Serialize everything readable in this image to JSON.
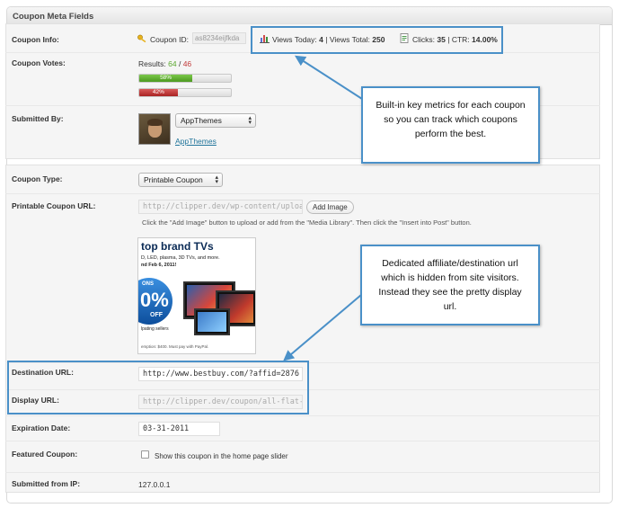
{
  "metabox": {
    "title": "Coupon Meta Fields"
  },
  "fields": {
    "coupon_info": {
      "label": "Coupon Info:",
      "id_label": "Coupon ID:",
      "id_value": "as8234eijfkda",
      "views_today_label": "Views Today:",
      "views_today": "4",
      "views_total_label": "| Views Total:",
      "views_total": "250",
      "clicks_label": "Clicks:",
      "clicks": "35",
      "ctr_label": "| CTR:",
      "ctr": "14.00%"
    },
    "coupon_votes": {
      "label": "Coupon Votes:",
      "results_label": "Results:",
      "up": "64",
      "separator": "/",
      "down": "46",
      "up_pct_label": "58%",
      "down_pct_label": "42%",
      "up_pct": 0.58,
      "down_pct": 0.42
    },
    "submitted_by": {
      "label": "Submitted By:",
      "select_value": "AppThemes",
      "link": "AppThemes"
    },
    "coupon_type": {
      "label": "Coupon Type:",
      "select_value": "Printable Coupon"
    },
    "printable_url": {
      "label": "Printable Coupon URL:",
      "value": "http://clipper.dev/wp-content/uploads/20",
      "button": "Add Image",
      "help": "Click the \"Add Image\" button to upload or add from the \"Media Library\". Then click the \"Insert into Post\" button."
    },
    "coupon_image": {
      "headline": "top brand TVs",
      "line1": "D, LED, plasma, 3D TVs, and more.",
      "line2": "nd Feb 6, 2011!",
      "badge_big": "0%",
      "badge_small": "OFF",
      "badge_top": "ONS",
      "footer": "emption: $400. Must pay with PayPal.",
      "side": "lpating sellers"
    },
    "destination_url": {
      "label": "Destination URL:",
      "value": "http://www.bestbuy.com/?affid=2876"
    },
    "display_url": {
      "label": "Display URL:",
      "value": "http://clipper.dev/coupon/all-flat-screen-"
    },
    "expiration": {
      "label": "Expiration Date:",
      "value": "03-31-2011"
    },
    "featured": {
      "label": "Featured Coupon:",
      "checkbox_label": "Show this coupon in the home page slider",
      "checked": false
    },
    "submitted_ip": {
      "label": "Submitted from IP:",
      "value": "127.0.0.1"
    }
  },
  "callouts": {
    "metrics": "Built-in key metrics for each coupon so you can track which coupons perform the best.",
    "affiliate": "Dedicated affiliate/destination url which is hidden from site visitors. Instead they see the pretty display url."
  },
  "colors": {
    "callout_border": "#4a90c8",
    "vote_up": "#5aa82f",
    "vote_down": "#c23b3b",
    "link": "#21759b"
  }
}
